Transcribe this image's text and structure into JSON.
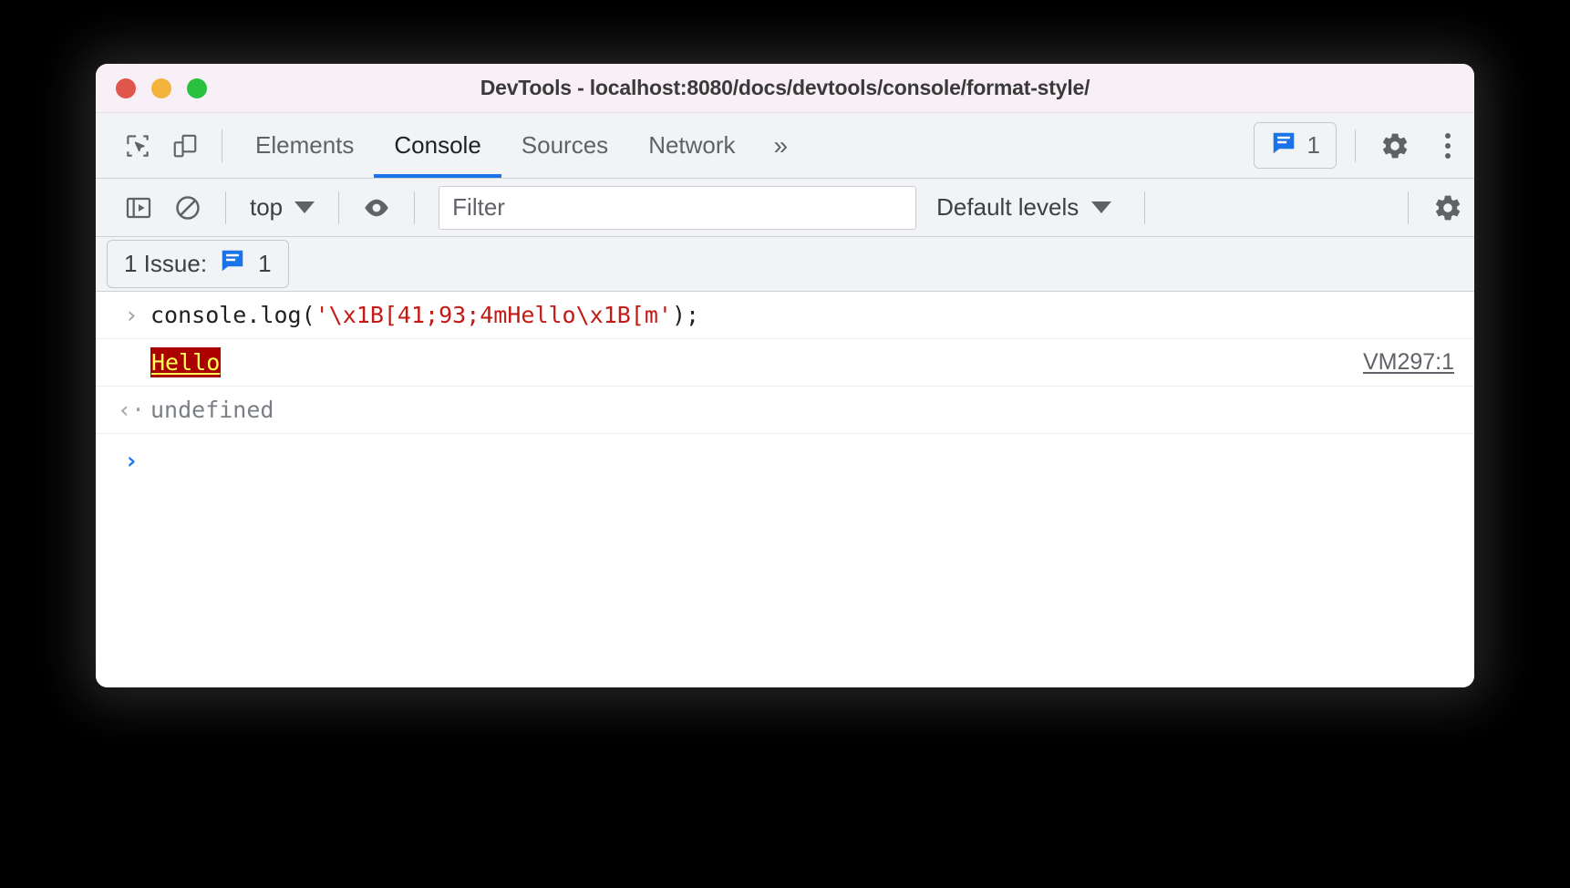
{
  "window": {
    "title": "DevTools - localhost:8080/docs/devtools/console/format-style/",
    "traffic_lights": [
      {
        "name": "close",
        "color": "#e0564c"
      },
      {
        "name": "minimize",
        "color": "#f3b43c"
      },
      {
        "name": "maximize",
        "color": "#2ac13e"
      }
    ]
  },
  "tabbar": {
    "inspect_icon": "inspect-element-icon",
    "device_icon": "device-toolbar-icon",
    "tabs": [
      {
        "label": "Elements",
        "active": false
      },
      {
        "label": "Console",
        "active": true
      },
      {
        "label": "Sources",
        "active": false
      },
      {
        "label": "Network",
        "active": false
      }
    ],
    "overflow_label": "»",
    "issues_badge": {
      "icon": "issues-speech-bubble-icon",
      "count": "1",
      "color": "#1a73e8"
    },
    "settings_icon": "gear-icon",
    "more_icon": "kebab-menu-icon",
    "active_tab_underline_color": "#1a73e8"
  },
  "console_toolbar": {
    "sidebar_toggle_icon": "console-sidebar-icon",
    "clear_icon": "clear-console-icon",
    "context": {
      "label": "top",
      "caret": "▼"
    },
    "live_expression_icon": "eye-icon",
    "filter": {
      "placeholder": "Filter",
      "value": ""
    },
    "levels": {
      "label": "Default levels",
      "caret": "▼"
    },
    "settings_icon": "console-settings-gear-icon"
  },
  "issues_bar": {
    "label": "1 Issue:",
    "badge_icon": "issues-speech-bubble-icon",
    "count": "1"
  },
  "console": {
    "rows": [
      {
        "type": "input",
        "gutter": "›",
        "code_before": "console.log(",
        "code_string": "'\\x1B[41;93;4mHello\\x1B[m'",
        "code_after": ");"
      },
      {
        "type": "output",
        "text": "Hello",
        "bg_color": "#aa0000",
        "fg_color": "#ffff55",
        "underline": true,
        "source_link": "VM297:1"
      },
      {
        "type": "result",
        "gutter": "‹·",
        "text": "undefined"
      },
      {
        "type": "prompt",
        "gutter": "›",
        "text": ""
      }
    ]
  }
}
